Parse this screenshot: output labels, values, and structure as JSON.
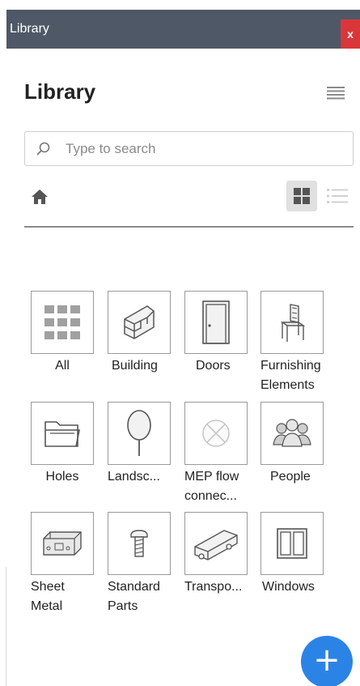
{
  "window": {
    "title": "Library",
    "close_glyph": "x"
  },
  "header": {
    "title": "Library",
    "menu_icon": "hamburger-menu-icon"
  },
  "search": {
    "placeholder": "Type to search",
    "value": "",
    "icon": "search-icon"
  },
  "toolbar": {
    "home_icon": "home-icon",
    "view_modes": [
      "grid",
      "list"
    ],
    "active_view": "grid"
  },
  "categories": [
    {
      "label": "All",
      "icon": "grid-all-icon"
    },
    {
      "label": "Building",
      "icon": "stairs-icon"
    },
    {
      "label": "Doors",
      "icon": "door-icon"
    },
    {
      "label": "Furnishing\nElements",
      "icon": "chair-icon"
    },
    {
      "label": "Holes",
      "icon": "folder-icon"
    },
    {
      "label": "Landsc...",
      "icon": "tree-icon"
    },
    {
      "label": "MEP flow\nconnec...",
      "icon": "mep-connector-icon"
    },
    {
      "label": "People",
      "icon": "people-icon"
    },
    {
      "label": "Sheet\nMetal",
      "icon": "sheet-metal-icon"
    },
    {
      "label": "Standard\nParts",
      "icon": "screw-icon"
    },
    {
      "label": "Transpo...",
      "icon": "truck-icon"
    },
    {
      "label": "Windows",
      "icon": "window-icon"
    }
  ],
  "fab": {
    "label": "+"
  },
  "colors": {
    "titlebar": "#4f5866",
    "close": "#d9363a",
    "accent": "#2c83e6"
  }
}
